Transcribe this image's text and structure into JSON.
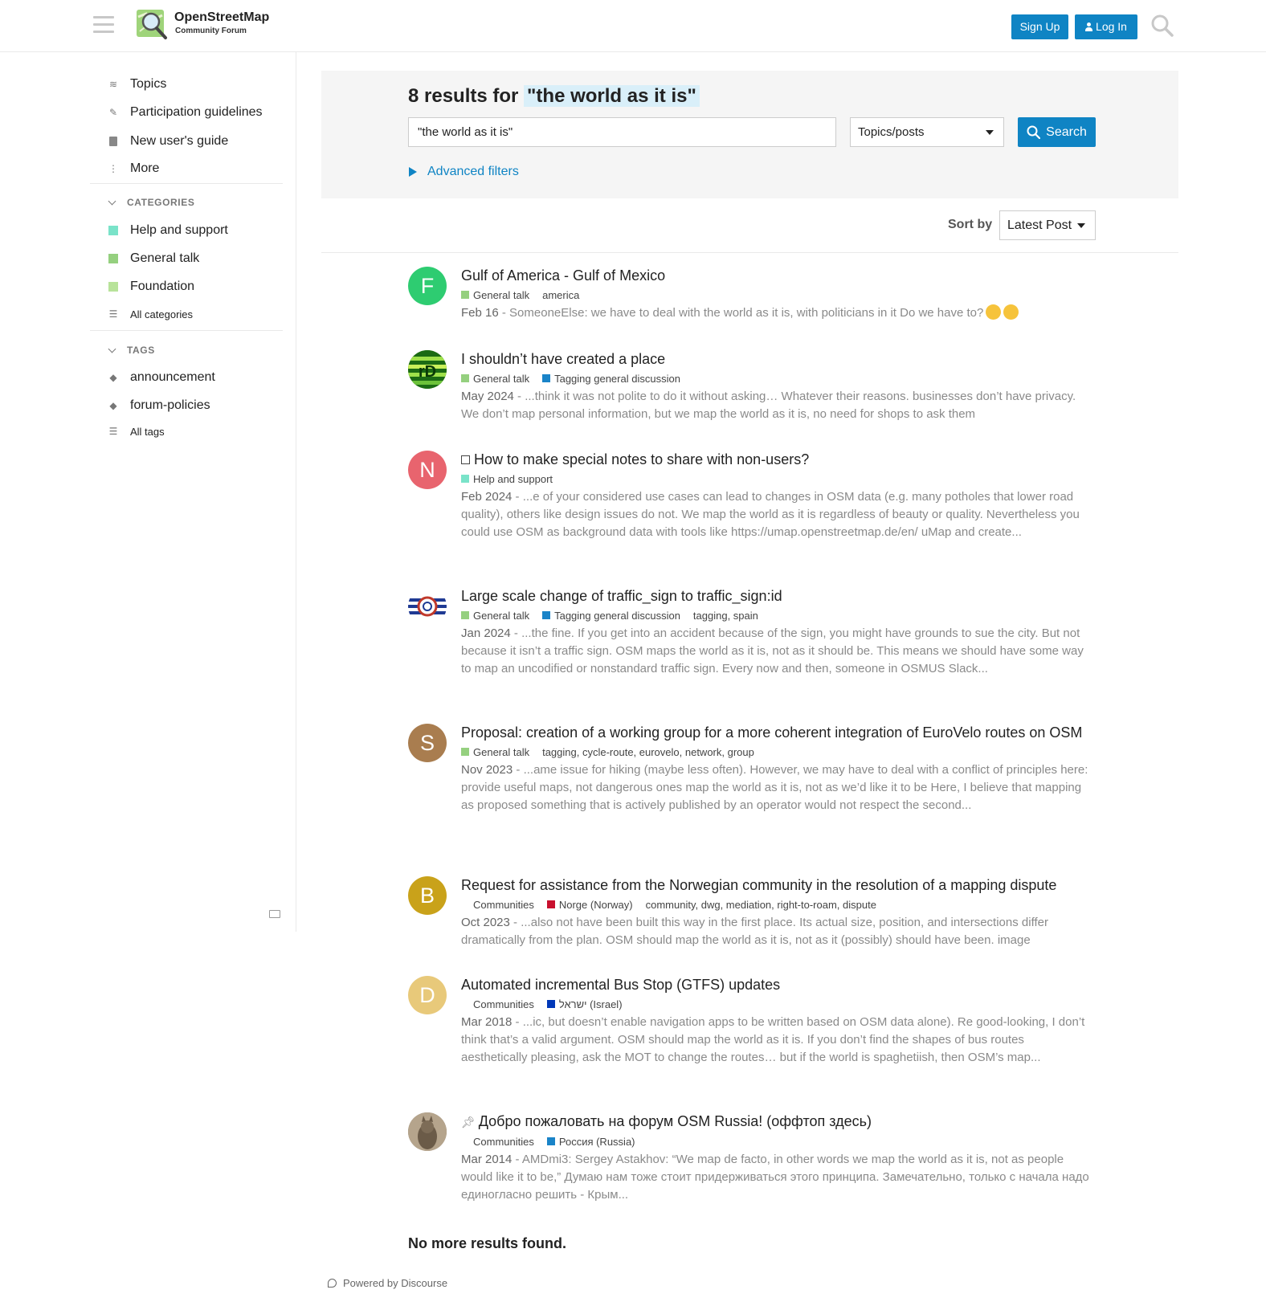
{
  "header": {
    "site_title": "OpenStreetMap",
    "site_subtitle": "Community Forum",
    "signup_label": "Sign Up",
    "login_label": "Log In",
    "accent_color": "#0f84c4"
  },
  "sidebar": {
    "nav": [
      {
        "label": "Topics",
        "icon": "layers-icon"
      },
      {
        "label": "Participation guidelines",
        "icon": "guidelines-icon"
      },
      {
        "label": "New user's guide",
        "icon": "book-icon"
      },
      {
        "label": "More",
        "icon": "vertical-ellipsis-icon"
      }
    ],
    "categories_heading": "CATEGORIES",
    "categories": [
      {
        "label": "Help and support",
        "color": "#7ae3c9"
      },
      {
        "label": "General talk",
        "color": "#95d07f"
      },
      {
        "label": "Foundation",
        "color": "#b8e39a"
      }
    ],
    "all_categories": "All categories",
    "tags_heading": "TAGS",
    "tags": [
      {
        "label": "announcement"
      },
      {
        "label": "forum-policies"
      }
    ],
    "all_tags": "All tags"
  },
  "search": {
    "heading_prefix": "8 results for ",
    "heading_query": "\"the world as it is\"",
    "input_value": "\"the world as it is\"",
    "type_select": "Topics/posts",
    "search_button": "Search",
    "advanced_filters": "Advanced filters",
    "sort_label": "Sort by",
    "sort_value": "Latest Post"
  },
  "results": [
    {
      "title": "Gulf of America - Gulf of Mexico",
      "avatar_letter": "F",
      "avatar_color": "#2ecc71",
      "categories": [
        {
          "label": "General talk",
          "color": "#95d07f"
        }
      ],
      "tags": "america",
      "date": "Feb 16",
      "blurb": "SomeoneElse: we have to deal with the world as it is, with politicians in it Do we have to?"
    },
    {
      "title": "I shouldn’t have created a place",
      "avatar_letter": "",
      "avatar_color": "#5a9e1f",
      "categories": [
        {
          "label": "General talk",
          "color": "#95d07f"
        },
        {
          "label": "Tagging general discussion",
          "color": "#1a84c8"
        }
      ],
      "tags": "",
      "date": "May 2024",
      "blurb": "...think it was not polite to do it without asking… Whatever their reasons. businesses don’t have privacy. We don’t map personal information, but we map the world as it is, no need for shops to ask them"
    },
    {
      "title": "How to make special notes to share with non-users?",
      "avatar_letter": "N",
      "avatar_color": "#e8646e",
      "categories": [
        {
          "label": "Help and support",
          "color": "#7ae3c9"
        }
      ],
      "tags": "",
      "date": "Feb 2024",
      "blurb": "...e of your considered use cases can lead to changes in OSM data (e.g. many potholes that lower road quality), others like design issues do not. We map the world as it is regardless of beauty or quality. Nevertheless you could use OSM as background data with tools like https://umap.openstreetmap.de/en/ uMap and create..."
    },
    {
      "title": "Large scale change of traffic_sign to traffic_sign:id",
      "avatar_letter": "",
      "avatar_color": "#ffffff",
      "categories": [
        {
          "label": "General talk",
          "color": "#95d07f"
        },
        {
          "label": "Tagging general discussion",
          "color": "#1a84c8"
        }
      ],
      "tags": "tagging, spain",
      "date": "Jan 2024",
      "blurb": "...the fine. If you get into an accident because of the sign, you might have grounds to sue the city. But not because it isn’t a traffic sign. OSM maps the world as it is, not as it should be. This means we should have some way to map an uncodified or nonstandard traffic sign. Every now and then, someone in OSMUS Slack..."
    },
    {
      "title": "Proposal: creation of a working group for a more coherent integration of EuroVelo routes on OSM",
      "avatar_letter": "S",
      "avatar_color": "#a97d4f",
      "categories": [
        {
          "label": "General talk",
          "color": "#95d07f"
        }
      ],
      "tags": "tagging, cycle-route, eurovelo, network, group",
      "date": "Nov 2023",
      "blurb": "...ame issue for hiking (maybe less often). However, we may have to deal with a conflict of principles here: provide useful maps, not dangerous ones map the world as it is, not as we’d like it to be Here, I believe that mapping as proposed something that is actively published by an operator would not respect the second..."
    },
    {
      "title": "Request for assistance from the Norwegian community in the resolution of a mapping dispute",
      "avatar_letter": "B",
      "avatar_color": "#c9a21a",
      "categories": [
        {
          "label": "Communities",
          "color": ""
        },
        {
          "label": "Norge (Norway)",
          "color": "#c8102e"
        }
      ],
      "tags": "community, dwg, mediation, right-to-roam, dispute",
      "date": "Oct 2023",
      "blurb": "...also not have been built this way in the first place. Its actual size, position, and intersections differ dramatically from the plan. OSM should map the world as it is, not as it (possibly) should have been. image"
    },
    {
      "title": "Automated incremental Bus Stop (GTFS) updates",
      "avatar_letter": "D",
      "avatar_color": "#e8c97a",
      "categories": [
        {
          "label": "Communities",
          "color": ""
        },
        {
          "label": "ישראל (Israel)",
          "color": "#0038b8"
        }
      ],
      "tags": "",
      "date": "Mar 2018",
      "blurb": "...ic, but doesn’t enable navigation apps to be written based on OSM data alone). Re good-looking, I don’t think that’s a valid argument. OSM should map the world as it is. If you don’t find the shapes of bus routes aesthetically pleasing, ask the MOT to change the routes… but if the world is spaghetiish, then OSM’s map..."
    },
    {
      "title": "Добро пожаловать на форум OSM Russia! (оффтоп здесь)",
      "avatar_letter": "",
      "avatar_color": "#8a7a66",
      "categories": [
        {
          "label": "Communities",
          "color": ""
        },
        {
          "label": "Россия (Russia)",
          "color": "#1a84c8"
        }
      ],
      "tags": "",
      "date": "Mar 2014",
      "blurb": "AMDmi3: Sergey Astakhov: “We map de facto, in other words we map the world as it is, not as people would like it to be,” Думаю нам тоже стоит придерживаться этого принципа. Замечательно, только с начала надо единогласно решить - Крым..."
    }
  ],
  "footer": {
    "no_more": "No more results found.",
    "powered_by": "Powered by Discourse"
  }
}
